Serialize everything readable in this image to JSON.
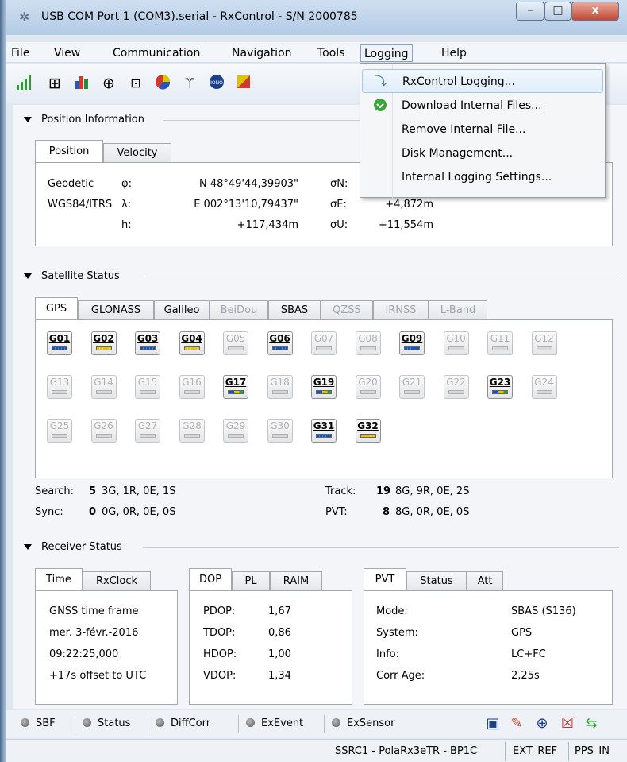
{
  "window": {
    "title": "USB COM Port 1 (COM3).serial - RxControl - S/N 2000785",
    "minimize": "–",
    "maximize": "□",
    "close": "x"
  },
  "menubar": {
    "items": [
      "File",
      "View",
      "Communication",
      "Navigation",
      "Tools",
      "Logging",
      "Help"
    ]
  },
  "toolbar": {
    "icons": [
      "signal-strength-icon",
      "grid-icon",
      "bar-chart-icon",
      "crosshair-icon",
      "plus-box-icon",
      "pie-chart-icon",
      "antenna-icon",
      "iono-icon",
      "sky-plot-icon"
    ]
  },
  "logging_menu": {
    "items": [
      {
        "label": "RxControl Logging...",
        "icon": "logging-icon"
      },
      {
        "label": "Download Internal Files...",
        "icon": "download-icon"
      },
      {
        "label": "Remove Internal File...",
        "icon": ""
      },
      {
        "label": "Disk Management...",
        "icon": ""
      },
      {
        "label": "Internal Logging Settings...",
        "icon": ""
      }
    ]
  },
  "position": {
    "header": "Position Information",
    "tabs": [
      "Position",
      "Velocity"
    ],
    "rows": [
      [
        "Geodetic",
        "φ:",
        "N 48°49'44,39903\"",
        "σN:"
      ],
      [
        "WGS84/ITRS",
        "λ:",
        "E 002°13'10,79437\"",
        "σE:",
        "+4,872m"
      ],
      [
        "",
        "h:",
        "+117,434m",
        "σU:",
        "+11,554m"
      ]
    ]
  },
  "satellite": {
    "header": "Satellite Status",
    "tabs": [
      "GPS",
      "GLONASS",
      "Galileo",
      "BeiDou",
      "SBAS",
      "QZSS",
      "IRNSS",
      "L-Band"
    ],
    "sats": [
      {
        "id": "G01",
        "on": true,
        "bar": "g"
      },
      {
        "id": "G02",
        "on": true,
        "bar": "y"
      },
      {
        "id": "G03",
        "on": true,
        "bar": "g"
      },
      {
        "id": "G04",
        "on": true,
        "bar": "y"
      },
      {
        "id": "G05",
        "on": false
      },
      {
        "id": "G06",
        "on": true,
        "bar": "g"
      },
      {
        "id": "G07",
        "on": false
      },
      {
        "id": "G08",
        "on": false
      },
      {
        "id": "G09",
        "on": true,
        "bar": "g"
      },
      {
        "id": "G10",
        "on": false
      },
      {
        "id": "G11",
        "on": false
      },
      {
        "id": "G12",
        "on": false
      },
      {
        "id": "G13",
        "on": false
      },
      {
        "id": "G14",
        "on": false
      },
      {
        "id": "G15",
        "on": false
      },
      {
        "id": "G16",
        "on": false
      },
      {
        "id": "G17",
        "on": true,
        "bar": "m"
      },
      {
        "id": "G18",
        "on": false
      },
      {
        "id": "G19",
        "on": true,
        "bar": "m"
      },
      {
        "id": "G20",
        "on": false
      },
      {
        "id": "G21",
        "on": false
      },
      {
        "id": "G22",
        "on": false
      },
      {
        "id": "G23",
        "on": true,
        "bar": "m"
      },
      {
        "id": "G24",
        "on": false
      },
      {
        "id": "G25",
        "on": false
      },
      {
        "id": "G26",
        "on": false
      },
      {
        "id": "G27",
        "on": false
      },
      {
        "id": "G28",
        "on": false
      },
      {
        "id": "G29",
        "on": false
      },
      {
        "id": "G30",
        "on": false
      },
      {
        "id": "G31",
        "on": true,
        "bar": "g"
      },
      {
        "id": "G32",
        "on": true,
        "bar": "y"
      }
    ],
    "search_label": "Search:",
    "search_count": "5",
    "search_detail": "3G, 1R, 0E, 1S",
    "sync_label": "Sync:",
    "sync_count": "0",
    "sync_detail": "0G, 0R, 0E, 0S",
    "track_label": "Track:",
    "track_count": "19",
    "track_detail": "8G, 9R, 0E, 2S",
    "pvt_label": "PVT:",
    "pvt_count": "8",
    "pvt_detail": "8G, 0R, 0E, 0S"
  },
  "receiver": {
    "header": "Receiver Status",
    "time": {
      "tabs": [
        "Time",
        "RxClock"
      ],
      "lines": [
        "GNSS time frame",
        "mer. 3-févr.-2016",
        "09:22:25,000",
        "+17s offset to UTC"
      ]
    },
    "dop": {
      "tabs": [
        "DOP",
        "PL",
        "RAIM"
      ],
      "rows": [
        [
          "PDOP:",
          "1,67"
        ],
        [
          "TDOP:",
          "0,86"
        ],
        [
          "HDOP:",
          "1,00"
        ],
        [
          "VDOP:",
          "1,34"
        ]
      ]
    },
    "pvt": {
      "tabs": [
        "PVT",
        "Status",
        "Att"
      ],
      "rows": [
        [
          "Mode:",
          "SBAS (S136)"
        ],
        [
          "System:",
          "GPS"
        ],
        [
          "Info:",
          "LC+FC"
        ],
        [
          "Corr Age:",
          "2,25s"
        ]
      ]
    }
  },
  "statusbar": {
    "items": [
      "SBF",
      "Status",
      "DiffCorr",
      "ExEvent",
      "ExSensor"
    ],
    "right_icons": [
      "save-icon",
      "edit-icon",
      "target-icon",
      "cancel-icon",
      "swap-icon"
    ]
  },
  "infobar": {
    "receiver": "SSRC1 - PolaRx3eTR - BP1C",
    "ref": "EXT_REF",
    "pps": "PPS_IN"
  }
}
